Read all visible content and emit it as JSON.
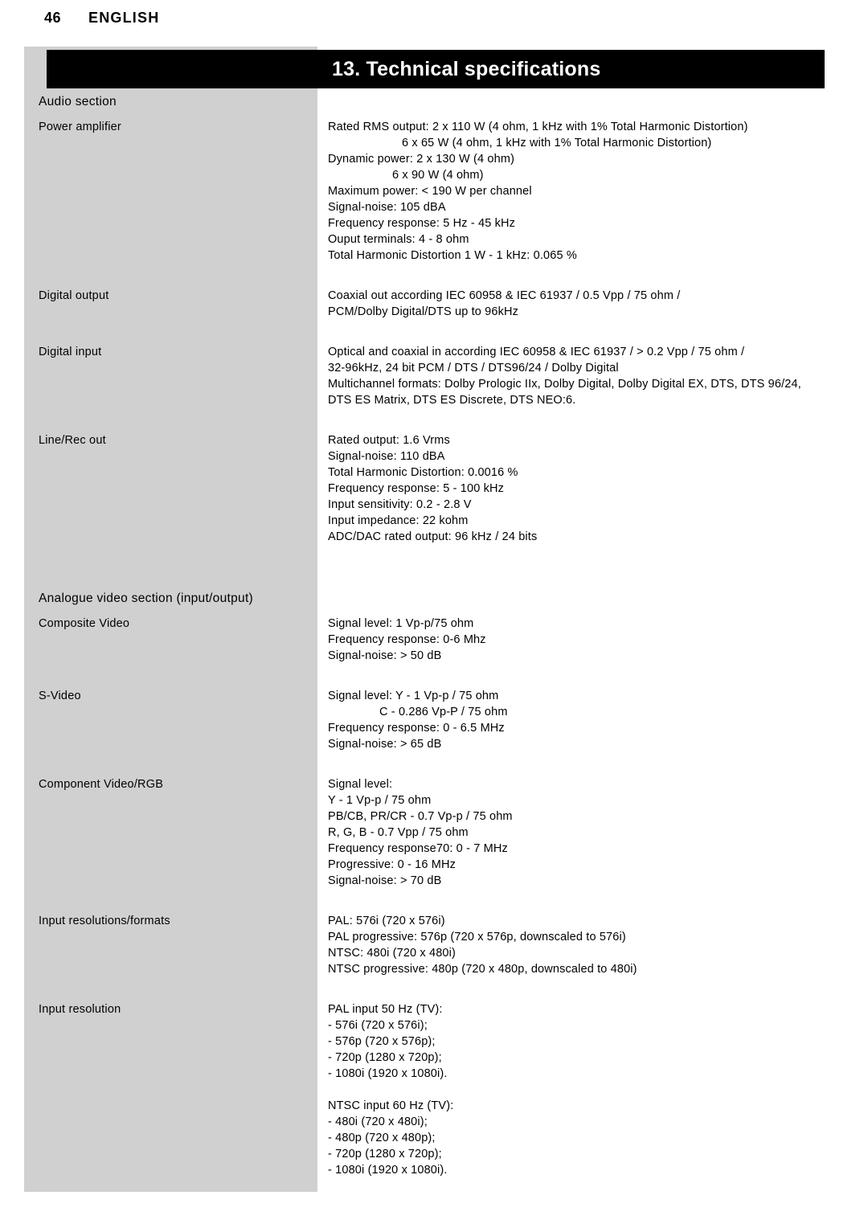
{
  "header": {
    "page_number": "46",
    "language": "ENGLISH"
  },
  "title_bar": {
    "title": "13. Technical specifications"
  },
  "sections": [
    {
      "heading": "Audio section",
      "rows": [
        {
          "label": "Power amplifier",
          "lines": [
            {
              "text": "Rated RMS output: 2 x 110 W (4 ohm, 1 kHz with 1% Total Harmonic Distortion)",
              "indent": 0
            },
            {
              "text": "6 x 65 W (4 ohm, 1 kHz with 1% Total Harmonic Distortion)",
              "indent": 1
            },
            {
              "text": "Dynamic power: 2 x 130 W (4 ohm)",
              "indent": 0
            },
            {
              "text": "6 x 90 W (4 ohm)",
              "indent": 2
            },
            {
              "text": "Maximum power: < 190 W per channel",
              "indent": 0
            },
            {
              "text": "Signal-noise: 105 dBA",
              "indent": 0
            },
            {
              "text": "Frequency response: 5 Hz - 45 kHz",
              "indent": 0
            },
            {
              "text": "Ouput terminals: 4 - 8 ohm",
              "indent": 0
            },
            {
              "text": "Total Harmonic Distortion 1 W - 1 kHz: 0.065 %",
              "indent": 0
            }
          ]
        },
        {
          "label": "Digital output",
          "lines": [
            {
              "text": "Coaxial out according IEC 60958 & IEC 61937 / 0.5 Vpp / 75 ohm /",
              "indent": 0
            },
            {
              "text": "PCM/Dolby Digital/DTS up to 96kHz",
              "indent": 0
            }
          ]
        },
        {
          "label": "Digital input",
          "lines": [
            {
              "text": "Optical and coaxial in according IEC 60958 & IEC 61937 / > 0.2 Vpp / 75 ohm /",
              "indent": 0
            },
            {
              "text": "32-96kHz, 24 bit PCM / DTS / DTS96/24 / Dolby Digital",
              "indent": 0
            },
            {
              "text": "Multichannel formats: Dolby Prologic IIx, Dolby Digital, Dolby Digital EX, DTS, DTS 96/24,",
              "indent": 0
            },
            {
              "text": "DTS ES Matrix, DTS ES Discrete, DTS NEO:6.",
              "indent": 0
            }
          ]
        },
        {
          "label": "Line/Rec out",
          "lines": [
            {
              "text": "Rated output: 1.6 Vrms",
              "indent": 0
            },
            {
              "text": "Signal-noise: 110 dBA",
              "indent": 0
            },
            {
              "text": "Total Harmonic Distortion: 0.0016 %",
              "indent": 0
            },
            {
              "text": "Frequency response: 5 - 100 kHz",
              "indent": 0
            },
            {
              "text": "Input sensitivity: 0.2 - 2.8 V",
              "indent": 0
            },
            {
              "text": "Input impedance: 22 kohm",
              "indent": 0
            },
            {
              "text": "ADC/DAC rated output: 96 kHz / 24 bits",
              "indent": 0
            }
          ]
        }
      ]
    },
    {
      "heading": "Analogue video section (input/output)",
      "rows": [
        {
          "label": "Composite Video",
          "lines": [
            {
              "text": "Signal level: 1 Vp-p/75 ohm",
              "indent": 0
            },
            {
              "text": "Frequency response: 0-6 Mhz",
              "indent": 0
            },
            {
              "text": "Signal-noise: > 50 dB",
              "indent": 0
            }
          ]
        },
        {
          "label": "S-Video",
          "lines": [
            {
              "text": "Signal level: Y - 1 Vp-p / 75 ohm",
              "indent": 0
            },
            {
              "text": "C - 0.286 Vp-P / 75 ohm",
              "indent": 3
            },
            {
              "text": "Frequency response: 0 - 6.5 MHz",
              "indent": 0
            },
            {
              "text": "Signal-noise: > 65 dB",
              "indent": 0
            }
          ]
        },
        {
          "label": "Component Video/RGB",
          "lines": [
            {
              "text": "Signal level:",
              "indent": 0
            },
            {
              "text": "Y - 1 Vp-p / 75 ohm",
              "indent": 0
            },
            {
              "text": "PB/CB, PR/CR - 0.7 Vp-p / 75 ohm",
              "indent": 0
            },
            {
              "text": "R, G, B - 0.7 Vpp / 75 ohm",
              "indent": 0
            },
            {
              "text": "Frequency response70: 0 - 7 MHz",
              "indent": 0
            },
            {
              "text": "Progressive: 0 - 16 MHz",
              "indent": 0
            },
            {
              "text": "Signal-noise: > 70 dB",
              "indent": 0
            }
          ]
        },
        {
          "label": "Input resolutions/formats",
          "lines": [
            {
              "text": "PAL: 576i (720 x 576i)",
              "indent": 0
            },
            {
              "text": "PAL progressive: 576p (720 x 576p, downscaled to 576i)",
              "indent": 0
            },
            {
              "text": "NTSC: 480i (720 x 480i)",
              "indent": 0
            },
            {
              "text": "NTSC progressive: 480p (720 x 480p, downscaled to 480i)",
              "indent": 0
            }
          ]
        },
        {
          "label": "Input resolution",
          "lines": [
            {
              "text": "PAL input 50 Hz (TV):",
              "indent": 0
            },
            {
              "text": "- 576i (720 x 576i);",
              "indent": 0
            },
            {
              "text": "- 576p (720 x 576p);",
              "indent": 0
            },
            {
              "text": "- 720p (1280 x 720p);",
              "indent": 0
            },
            {
              "text": "- 1080i (1920 x 1080i).",
              "indent": 0
            },
            {
              "text": "",
              "indent": 0
            },
            {
              "text": "NTSC input 60 Hz (TV):",
              "indent": 0
            },
            {
              "text": "- 480i (720 x 480i);",
              "indent": 0
            },
            {
              "text": "- 480p (720 x 480p);",
              "indent": 0
            },
            {
              "text": "- 720p (1280 x 720p);",
              "indent": 0
            },
            {
              "text": "- 1080i (1920 x 1080i).",
              "indent": 0
            }
          ]
        }
      ]
    }
  ]
}
